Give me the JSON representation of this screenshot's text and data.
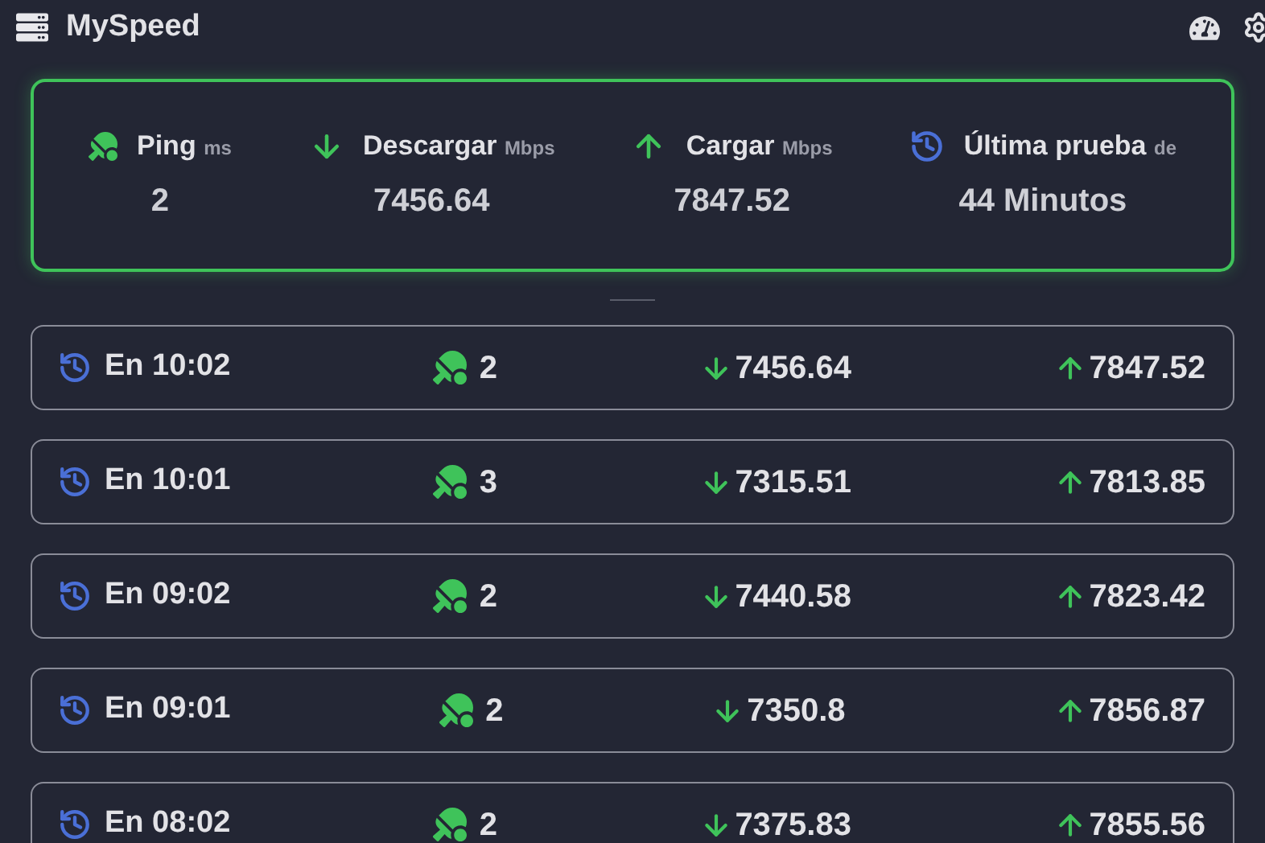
{
  "header": {
    "title": "MySpeed"
  },
  "summary": [
    {
      "kind": "ping",
      "label": "Ping",
      "unit": "ms",
      "value": "2"
    },
    {
      "kind": "download",
      "label": "Descargar",
      "unit": "Mbps",
      "value": "7456.64"
    },
    {
      "kind": "upload",
      "label": "Cargar",
      "unit": "Mbps",
      "value": "7847.52"
    },
    {
      "kind": "last",
      "label": "Última prueba",
      "unit": "de",
      "value": "44 Minutos"
    }
  ],
  "tests": [
    {
      "time": "En 10:02",
      "ping": "2",
      "download": "7456.64",
      "upload": "7847.52"
    },
    {
      "time": "En 10:01",
      "ping": "3",
      "download": "7315.51",
      "upload": "7813.85"
    },
    {
      "time": "En 09:02",
      "ping": "2",
      "download": "7440.58",
      "upload": "7823.42"
    },
    {
      "time": "En 09:01",
      "ping": "2",
      "download": "7350.8",
      "upload": "7856.87"
    },
    {
      "time": "En 08:02",
      "ping": "2",
      "download": "7375.83",
      "upload": "7855.56"
    }
  ]
}
